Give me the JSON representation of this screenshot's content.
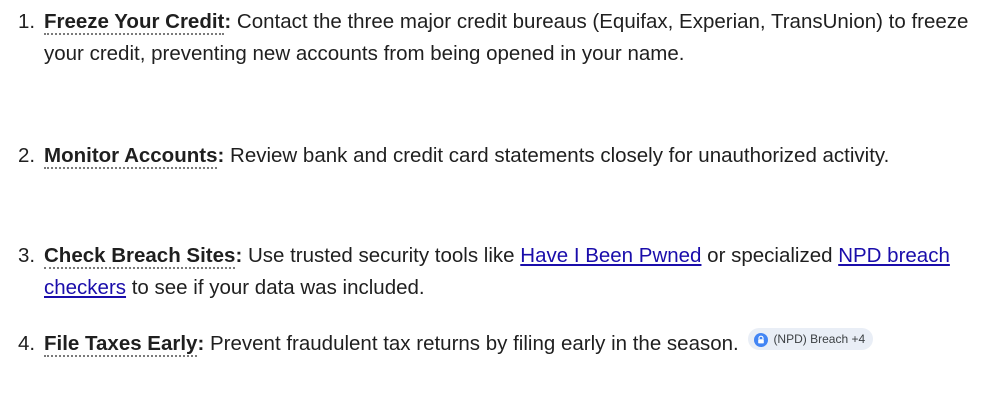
{
  "items": [
    {
      "number": "1.",
      "term": "Freeze Your Credit",
      "colon": ":",
      "text": " Contact the three major credit bureaus (Equifax, Experian, TransUnion) to freeze your credit, preventing new accounts from being opened in your name."
    },
    {
      "number": "2.",
      "term": "Monitor Accounts",
      "colon": ":",
      "text": " Review bank and credit card statements closely for unauthorized activity."
    },
    {
      "number": "3.",
      "term": "Check Breach Sites",
      "colon": ":",
      "text_before": " Use trusted security tools like ",
      "link1": "Have I Been Pwned",
      "text_middle": " or specialized ",
      "link2": "NPD breach checkers",
      "text_after": " to see if your data was included."
    },
    {
      "number": "4.",
      "term": "File Taxes Early",
      "colon": ":",
      "text": " Prevent fraudulent tax returns by filing early in the season."
    }
  ],
  "source_chip": {
    "label": "(NPD) Breach +4",
    "icon": "lock-icon",
    "icon_color": "#4285f4"
  },
  "colors": {
    "text": "#1f1f1f",
    "link": "#1a0dab",
    "chip_bg": "#e9eef6"
  }
}
